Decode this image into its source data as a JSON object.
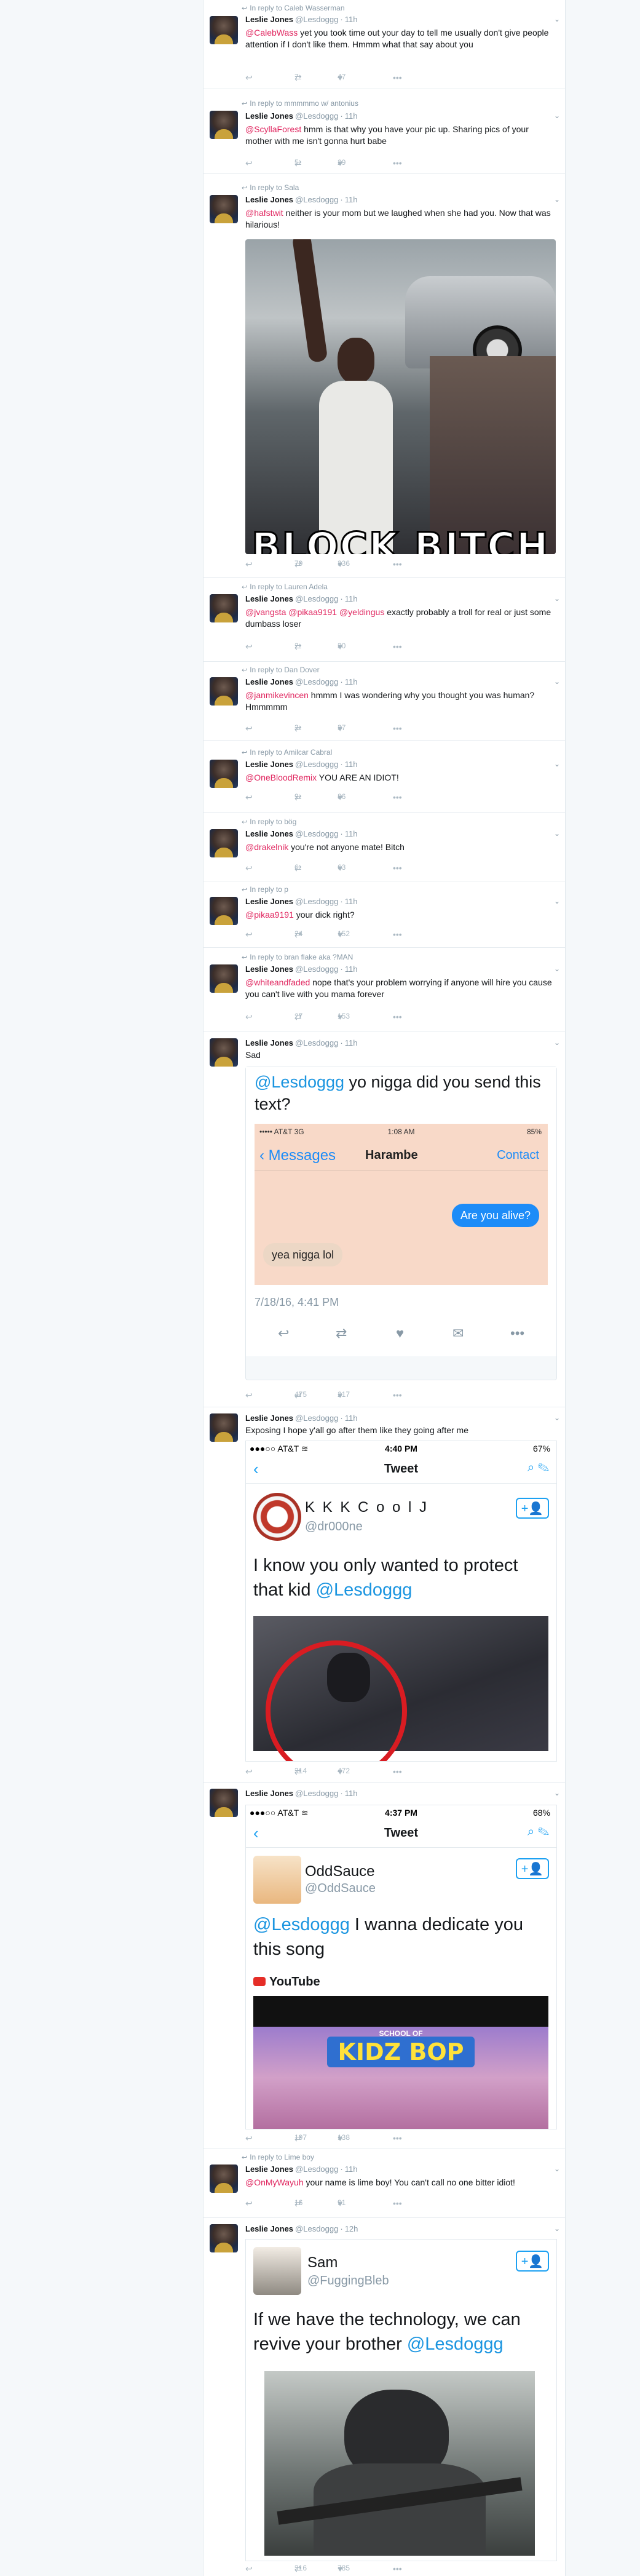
{
  "author": {
    "name": "Leslie Jones",
    "handle": "@Lesdoggg"
  },
  "action_icons": {
    "reply": "reply-icon",
    "retweet": "retweet-icon",
    "like": "heart-icon",
    "more": "more-icon",
    "caret": "chevron-down-icon"
  },
  "tweets": [
    {
      "reply_to": "In reply to Caleb Wasserman",
      "time": "11h",
      "mentions": [
        "@CalebWass"
      ],
      "text": " yet you took time out your day to tell me usually don't give people attention if I don't like them. Hmmm what that say about you",
      "retweets": "7",
      "likes": "47"
    },
    {
      "reply_to": "In reply to mmmmmo w/ antonius",
      "time": "11h",
      "mentions": [
        "@ScyllaForest"
      ],
      "text": " hmm is that why you have your pic up. Sharing pics of your mother with me isn't gonna hurt babe",
      "retweets": "5",
      "likes": "29"
    },
    {
      "reply_to": "In reply to Sala",
      "time": "11h",
      "mentions": [
        "@hafstwit"
      ],
      "text": " neither is your mom but we laughed when she had you. Now that was hilarious!",
      "retweets": "79",
      "likes": "336",
      "photo_caption": "BLOCK BITCH"
    },
    {
      "reply_to": "In reply to Lauren Adela",
      "time": "11h",
      "mentions": [
        "@jvangsta",
        "@pikaa9191",
        "@yeldingus"
      ],
      "text": " exactly probably a troll for real or just some dumbass loser",
      "retweets": "2",
      "likes": "30"
    },
    {
      "reply_to": "In reply to Dan Dover",
      "time": "11h",
      "mentions": [
        "@janmikevincen"
      ],
      "text": " hmmm I was wondering why you thought you was human? Hmmmmm",
      "retweets": "3",
      "likes": "37"
    },
    {
      "reply_to": "In reply to Amilcar Cabral",
      "time": "11h",
      "mentions": [
        "@OneBloodRemix"
      ],
      "text": " YOU  ARE  AN  IDIOT!",
      "retweets": "9",
      "likes": "86"
    },
    {
      "reply_to": "In reply to bög",
      "time": "11h",
      "mentions": [
        "@drakelnik"
      ],
      "text": " you're not anyone mate! Bitch",
      "retweets": "6",
      "likes": "63"
    },
    {
      "reply_to": "In reply to p",
      "time": "11h",
      "mentions": [
        "@pikaa9191"
      ],
      "text": " your dick right?",
      "retweets": "24",
      "likes": "152"
    },
    {
      "reply_to": "In reply to bran flake aka ?MAN",
      "time": "11h",
      "mentions": [
        "@whiteandfaded"
      ],
      "text": " nope that's your problem worrying if anyone will hire you cause you can't live with you mama forever",
      "retweets": "27",
      "likes": "153"
    },
    {
      "reply_to": "",
      "time": "11h",
      "mentions": [],
      "text": "Sad",
      "retweets": "475",
      "likes": "217",
      "card": {
        "mention": "@Lesdoggg",
        "text": " yo nigga did you send this text?",
        "status_left": "••••• AT&T 3G",
        "status_time": "1:08 AM",
        "status_right": "85%",
        "back": "Messages",
        "contact": "Harambe",
        "contact_btn": "Contact",
        "msg_sent": "Are you alive?",
        "msg_recv": "yea nigga lol",
        "date": "7/18/16, 4:41 PM"
      }
    },
    {
      "reply_to": "",
      "time": "11h",
      "mentions": [],
      "text": "Exposing I hope y'all go after them like they going after me",
      "retweets": "314",
      "likes": "472",
      "shot": {
        "status_left": "●●●○○ AT&T ≋",
        "status_time": "4:40 PM",
        "status_right": "67%",
        "title": "Tweet",
        "name": "K K K   C o o l   J",
        "handle": "@dr000ne",
        "mention": "@Lesdoggg",
        "text": "I know you only wanted to protect that kid "
      }
    },
    {
      "reply_to": "",
      "time": "11h",
      "mentions": [],
      "text": "",
      "retweets": "197",
      "likes": "138",
      "shot": {
        "status_left": "●●●○○ AT&T ≋",
        "status_time": "4:37 PM",
        "status_right": "68%",
        "title": "Tweet",
        "name": "OddSauce",
        "handle": "@OddSauce",
        "mention": "@Lesdoggg",
        "text": " I wanna dedicate you this song",
        "source": "YouTube",
        "thumb": "KIDZ BOP",
        "thumb_small": "SCHOOL OF"
      }
    },
    {
      "reply_to": "In reply to Lime boy",
      "time": "11h",
      "mentions": [
        "@OnMyWayuh"
      ],
      "text": " your name is lime boy! You can't call no one bitter idiot!",
      "retweets": "16",
      "likes": "91"
    },
    {
      "reply_to": "",
      "time": "12h",
      "mentions": [],
      "text": "",
      "retweets": "316",
      "likes": "785",
      "shot": {
        "name": "Sam",
        "handle": "@FuggingBleb",
        "mention": "@Lesdoggg",
        "text": "If we have the technology, we can revive your brother "
      }
    }
  ]
}
